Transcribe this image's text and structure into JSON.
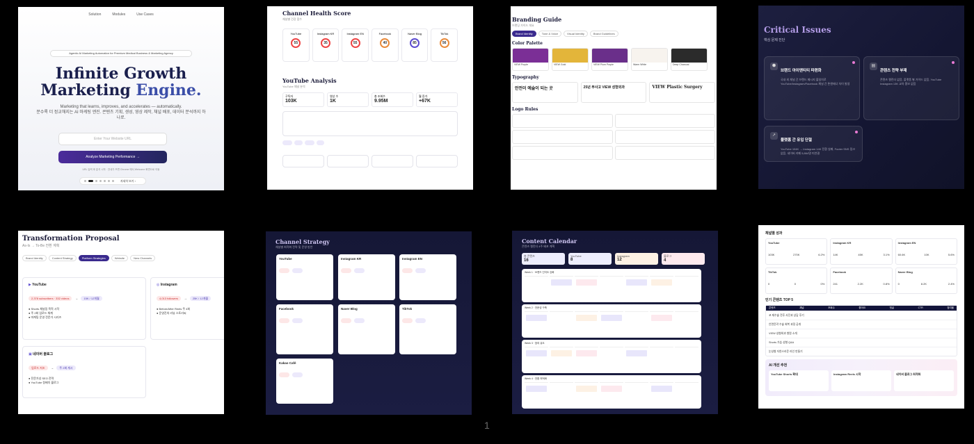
{
  "page_number": "1",
  "slide1": {
    "nav": [
      "Solution",
      "Modules",
      "Use Cases"
    ],
    "tagline": "Agentic AI Marketing Automation for Premium Medical Business & Marketing Agency",
    "title_line1": "Infinite Growth",
    "title_line2a": "Marketing",
    "title_line2b": "Engine.",
    "subtitle_line1": "Marketing that learns, improves, and accelerates — automatically.",
    "subtitle_line2": "분수록 더 정교해지는 AI 마케팅 엔진. 콘텐츠 기획, 생성, 영상 제작, 채널 배포, 데이터 분석까지 하",
    "subtitle_line3": "나로.",
    "url_placeholder": "Enter Your Website URL",
    "cta": "Analyze Marketing Performance →",
    "note": "URL 입력 후 분석 시작 · 안내가 뜨면 Chrome 에서 Welcome 화면으로 이동",
    "pager_label": "자세히 보기 ›"
  },
  "slide2": {
    "title": "Channel Health Score",
    "subtitle": "채널별 건강 점수",
    "scores": [
      {
        "name": "YouTube",
        "value": "55"
      },
      {
        "name": "Instagram KR",
        "value": "35"
      },
      {
        "name": "Instagram EN",
        "value": "55"
      },
      {
        "name": "Facebook",
        "value": "40"
      },
      {
        "name": "Naver Blog",
        "value": "85"
      },
      {
        "name": "TikTok",
        "value": "56"
      }
    ],
    "yt_title": "YouTube Analysis",
    "yt_subtitle": "YouTube 채널 분석",
    "stats": [
      {
        "label": "구독자",
        "value": "103K"
      },
      {
        "label": "영상 수",
        "value": "1K"
      },
      {
        "label": "총 조회수",
        "value": "9.95M"
      },
      {
        "label": "월 증가",
        "value": "+67K"
      }
    ]
  },
  "slide3": {
    "title": "Branding Guide",
    "subtitle": "브랜딩 가이드 개요",
    "tabs": [
      "Brand Identity",
      "Tone & Voice",
      "Visual Identity",
      "Brand Guidelines"
    ],
    "color_title": "Color Palette",
    "colors": [
      {
        "hex": "#7b2f96",
        "label": "VIEW Purple"
      },
      {
        "hex": "#e3b53a",
        "label": "VIEW Gold"
      },
      {
        "hex": "#6a2f8a",
        "label": "VIEW Plum Purple"
      },
      {
        "hex": "#f7f3ee",
        "label": "Warm White"
      },
      {
        "hex": "#2b2b2b",
        "label": "Deep Charcoal"
      }
    ],
    "typo_title": "Typography",
    "typo": [
      "안전이 예술이 되는 곳",
      "25년 무사고 VIEW 성형외과",
      "VIEW Plastic Surgery"
    ],
    "logo_title": "Logo Rules"
  },
  "slide4": {
    "title": "Critical Issues",
    "subtitle": "핵심 문제 진단",
    "issues": [
      {
        "title": "브랜드 아이덴티티 파편화",
        "body": "국내 외 채널 간 브랜드 메시지 불일치로 YouTube/Instagram/Facebook 채널 간 톤앤매너 차이 발생"
      },
      {
        "title": "콘텐츠 전략 부재",
        "body": "콘텐츠 캘린더 없음, 플랫폼 별 가이드 없음, YouTube Instagram 13K 교차 홍보 없음"
      },
      {
        "title": "플랫폼 간 유입 단절",
        "body": "YouTube 104K → Instagram 14K 전환 실패, Footer SNS 링크 없음, 네이버 카페 5,864명 미연결"
      }
    ]
  },
  "slide5": {
    "title": "Transformation Proposal",
    "subtitle": "As-Is → To-Be 전환 계획",
    "tabs": [
      "Brand Identity",
      "Content Strategy",
      "Platform Strategies",
      "Website",
      "New Channels"
    ],
    "cards": [
      {
        "name": "YouTube",
        "asis": "2,378 subscribers · 332 videos",
        "tobe": "15K / 12개월",
        "points": [
          "Shorts 채널링 목적 시작",
          "주 2회 업로드 체계",
          "마케팅 운영 전문가 시리즈"
        ]
      },
      {
        "name": "Instagram",
        "asis": "4,013 followers",
        "tobe": "25K / 12개월",
        "points": [
          "Before/After Reels 주 4회",
          "운영진의 리뷰 스토리씨"
        ]
      },
      {
        "name": "네이버 블로그",
        "asis": "업로드 저조",
        "tobe": "주 2회 게시",
        "points": [
          "전문가성 SEO 전략",
          "YouTube 정배치 블로그"
        ]
      }
    ]
  },
  "slide6": {
    "title": "Channel Strategy",
    "subtitle": "채널별 최적화 전략 및 운영 방안",
    "channels": [
      "YouTube",
      "Instagram KR",
      "Instagram EN",
      "Facebook",
      "Naver Blog",
      "TikTok",
      "Kakao Café"
    ]
  },
  "slide7": {
    "title": "Content Calendar",
    "subtitle": "콘텐츠 캘린더 4주 배포 계획",
    "kpis": [
      {
        "label": "총 콘텐츠",
        "value": "16"
      },
      {
        "label": "YouTube",
        "value": "8"
      },
      {
        "label": "Instagram",
        "value": "12"
      },
      {
        "label": "블로그",
        "value": "4"
      }
    ],
    "weeks": [
      "Week 1 · 브랜드 인지도 강화",
      "Week 2 · 전문성 구축",
      "Week 3 · 참여 유도",
      "Week 4 · 전환 최적화"
    ]
  },
  "slide8": {
    "title": "채널별 성과",
    "channels": [
      {
        "name": "YouTube",
        "vals": [
          "103K",
          "270K",
          "6.2%"
        ]
      },
      {
        "name": "Instagram KR",
        "vals": [
          "14K",
          "45K",
          "3.1%"
        ]
      },
      {
        "name": "Instagram EN",
        "vals": [
          "60.6K",
          "10K",
          "5.6%"
        ]
      },
      {
        "name": "TikTok",
        "vals": [
          "0",
          "0",
          "0%"
        ]
      },
      {
        "name": "Facebook",
        "vals": [
          "241",
          "2.2K",
          "0.8%"
        ]
      },
      {
        "name": "Naver Blog",
        "vals": [
          "0",
          "8.2K",
          "2.4%"
        ]
      }
    ],
    "top_title": "인기 콘텐츠 TOP 5",
    "columns": [
      "콘텐츠",
      "채널",
      "조회수",
      "좋아요",
      "댓글",
      "CTR",
      "참여율"
    ],
    "rows": [
      "코 재수술 전후 사진과 상담 후기",
      "안면윤곽 수술 회복 과정 공개",
      "VIEW 성형외과 병원 소개",
      "Shorts 가슴 성형 Q&A",
      "눈성형 자연스러운 라인 만들기"
    ],
    "ai_title": "AI 개선 추천",
    "ai_cards": [
      "YouTube Shorts 확대",
      "Instagram Reels 시작",
      "네이버 블로그 최적화"
    ]
  }
}
